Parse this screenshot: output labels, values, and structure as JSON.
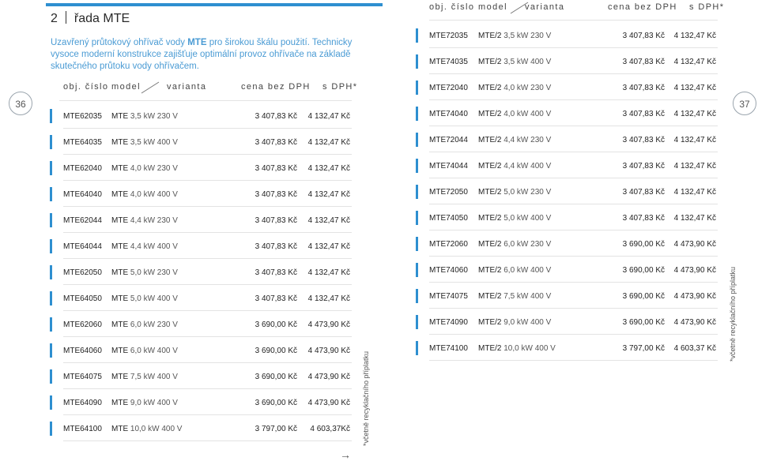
{
  "chapter": {
    "number": "2",
    "title": "řada MTE"
  },
  "intro": {
    "prefix": "Uzavřený průtokový ohřívač vody ",
    "brand": "MTE",
    "suffix": " pro širokou škálu použití. Technicky vysoce moderní konstrukce zajišťuje optimální provoz ohřívače na základě skutečného průtoku vody ohřívačem."
  },
  "headers": {
    "code": "obj. číslo",
    "model": "model",
    "variant": "varianta",
    "net": "cena bez DPH",
    "gross": "s DPH*"
  },
  "pages": {
    "left": "36",
    "right": "37"
  },
  "note": "*včetně recyklačního příplatku",
  "arrow": "→",
  "colors": {
    "accent": "#2e8fd0",
    "intro_text": "#4a9bd4"
  },
  "left_rows": [
    {
      "code": "MTE62035",
      "model": "MTE",
      "variant": "3,5 kW 230 V",
      "net": "3 407,83 Kč",
      "gross": "4 132,47 Kč"
    },
    {
      "code": "MTE64035",
      "model": "MTE",
      "variant": "3,5 kW 400 V",
      "net": "3 407,83 Kč",
      "gross": "4 132,47 Kč"
    },
    {
      "code": "MTE62040",
      "model": "MTE",
      "variant": "4,0 kW 230 V",
      "net": "3 407,83 Kč",
      "gross": "4 132,47 Kč"
    },
    {
      "code": "MTE64040",
      "model": "MTE",
      "variant": "4,0 kW 400 V",
      "net": "3 407,83 Kč",
      "gross": "4 132,47 Kč"
    },
    {
      "code": "MTE62044",
      "model": "MTE",
      "variant": "4,4 kW 230 V",
      "net": "3 407,83 Kč",
      "gross": "4 132,47 Kč"
    },
    {
      "code": "MTE64044",
      "model": "MTE",
      "variant": "4,4 kW 400 V",
      "net": "3 407,83 Kč",
      "gross": "4 132,47 Kč"
    },
    {
      "code": "MTE62050",
      "model": "MTE",
      "variant": "5,0 kW 230 V",
      "net": "3 407,83 Kč",
      "gross": "4 132,47 Kč"
    },
    {
      "code": "MTE64050",
      "model": "MTE",
      "variant": "5,0 kW 400 V",
      "net": "3 407,83 Kč",
      "gross": "4 132,47 Kč"
    },
    {
      "code": "MTE62060",
      "model": "MTE",
      "variant": "6,0 kW 230 V",
      "net": "3 690,00 Kč",
      "gross": "4 473,90 Kč"
    },
    {
      "code": "MTE64060",
      "model": "MTE",
      "variant": "6,0 kW 400 V",
      "net": "3 690,00 Kč",
      "gross": "4 473,90 Kč"
    },
    {
      "code": "MTE64075",
      "model": "MTE",
      "variant": "7,5 kW 400 V",
      "net": "3 690,00 Kč",
      "gross": "4 473,90 Kč"
    },
    {
      "code": "MTE64090",
      "model": "MTE",
      "variant": "9,0 kW 400 V",
      "net": "3 690,00 Kč",
      "gross": "4 473,90 Kč"
    },
    {
      "code": "MTE64100",
      "model": "MTE",
      "variant": "10,0 kW 400 V",
      "net": "3 797,00 Kč",
      "gross": "4 603,37Kč"
    }
  ],
  "right_rows": [
    {
      "code": "MTE72035",
      "model": "MTE/2",
      "variant": "3,5 kW 230 V",
      "net": "3 407,83 Kč",
      "gross": "4 132,47 Kč"
    },
    {
      "code": "MTE74035",
      "model": "MTE/2",
      "variant": "3,5 kW 400 V",
      "net": "3 407,83 Kč",
      "gross": "4 132,47 Kč"
    },
    {
      "code": "MTE72040",
      "model": "MTE/2",
      "variant": "4,0 kW 230 V",
      "net": "3 407,83 Kč",
      "gross": "4 132,47 Kč"
    },
    {
      "code": "MTE74040",
      "model": "MTE/2",
      "variant": "4,0 kW 400 V",
      "net": "3 407,83 Kč",
      "gross": "4 132,47 Kč"
    },
    {
      "code": "MTE72044",
      "model": "MTE/2",
      "variant": "4,4 kW 230 V",
      "net": "3 407,83 Kč",
      "gross": "4 132,47 Kč"
    },
    {
      "code": "MTE74044",
      "model": "MTE/2",
      "variant": "4,4 kW 400 V",
      "net": "3 407,83 Kč",
      "gross": "4 132,47 Kč"
    },
    {
      "code": "MTE72050",
      "model": "MTE/2",
      "variant": "5,0 kW 230 V",
      "net": "3 407,83 Kč",
      "gross": "4 132,47 Kč"
    },
    {
      "code": "MTE74050",
      "model": "MTE/2",
      "variant": "5,0 kW 400 V",
      "net": "3 407,83 Kč",
      "gross": "4 132,47 Kč"
    },
    {
      "code": "MTE72060",
      "model": "MTE/2",
      "variant": "6,0 kW 230 V",
      "net": "3 690,00 Kč",
      "gross": "4 473,90 Kč"
    },
    {
      "code": "MTE74060",
      "model": "MTE/2",
      "variant": "6,0 kW 400 V",
      "net": "3 690,00 Kč",
      "gross": "4 473,90 Kč"
    },
    {
      "code": "MTE74075",
      "model": "MTE/2",
      "variant": "7,5 kW 400 V",
      "net": "3 690,00 Kč",
      "gross": "4 473,90 Kč"
    },
    {
      "code": "MTE74090",
      "model": "MTE/2",
      "variant": "9,0 kW 400 V",
      "net": "3 690,00 Kč",
      "gross": "4 473,90 Kč"
    },
    {
      "code": "MTE74100",
      "model": "MTE/2",
      "variant": "10,0 kW 400 V",
      "net": "3 797,00 Kč",
      "gross": "4 603,37 Kč"
    }
  ]
}
